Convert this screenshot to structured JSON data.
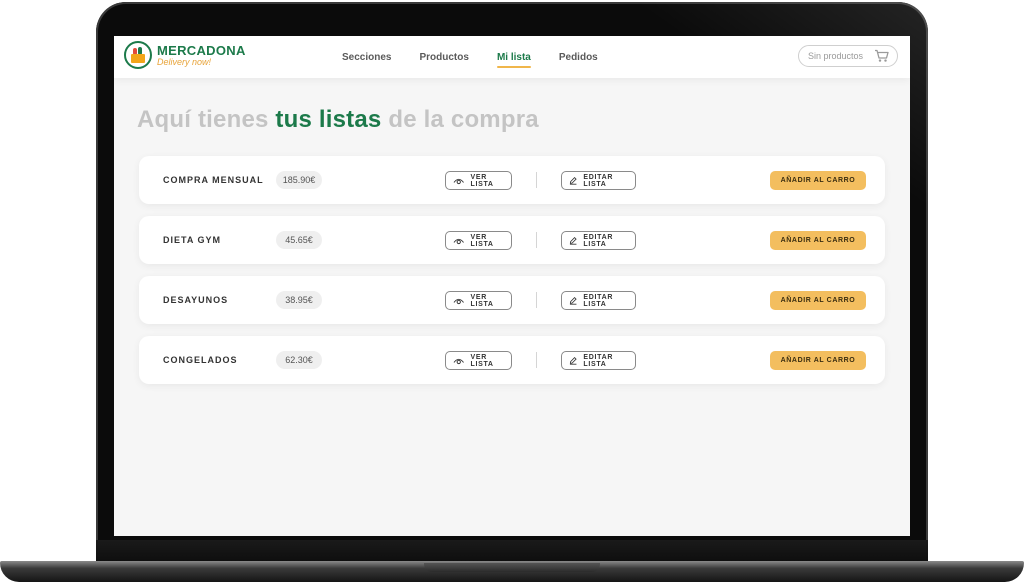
{
  "brand": {
    "name": "MERCADONA",
    "tagline": "Delivery now!",
    "primary_color": "#1c7a4a",
    "accent_color": "#f3be5f"
  },
  "nav": {
    "items": [
      {
        "label": "Secciones",
        "active": false
      },
      {
        "label": "Productos",
        "active": false
      },
      {
        "label": "Mi lista",
        "active": true
      },
      {
        "label": "Pedidos",
        "active": false
      }
    ]
  },
  "cart": {
    "label": "Sin productos",
    "icon": "shopping-cart-icon"
  },
  "page": {
    "heading_prefix": "Aquí tienes ",
    "heading_accent": "tus listas",
    "heading_suffix": " de la compra"
  },
  "actions": {
    "view_label": "VER LISTA",
    "view_icon": "eye-icon",
    "edit_label": "EDITAR LISTA",
    "edit_icon": "pencil-icon",
    "add_label": "AÑADIR AL CARRO"
  },
  "lists": [
    {
      "name": "COMPRA MENSUAL",
      "price": "185.90€"
    },
    {
      "name": "DIETA GYM",
      "price": "45.65€"
    },
    {
      "name": "DESAYUNOS",
      "price": "38.95€"
    },
    {
      "name": "CONGELADOS",
      "price": "62.30€"
    }
  ]
}
